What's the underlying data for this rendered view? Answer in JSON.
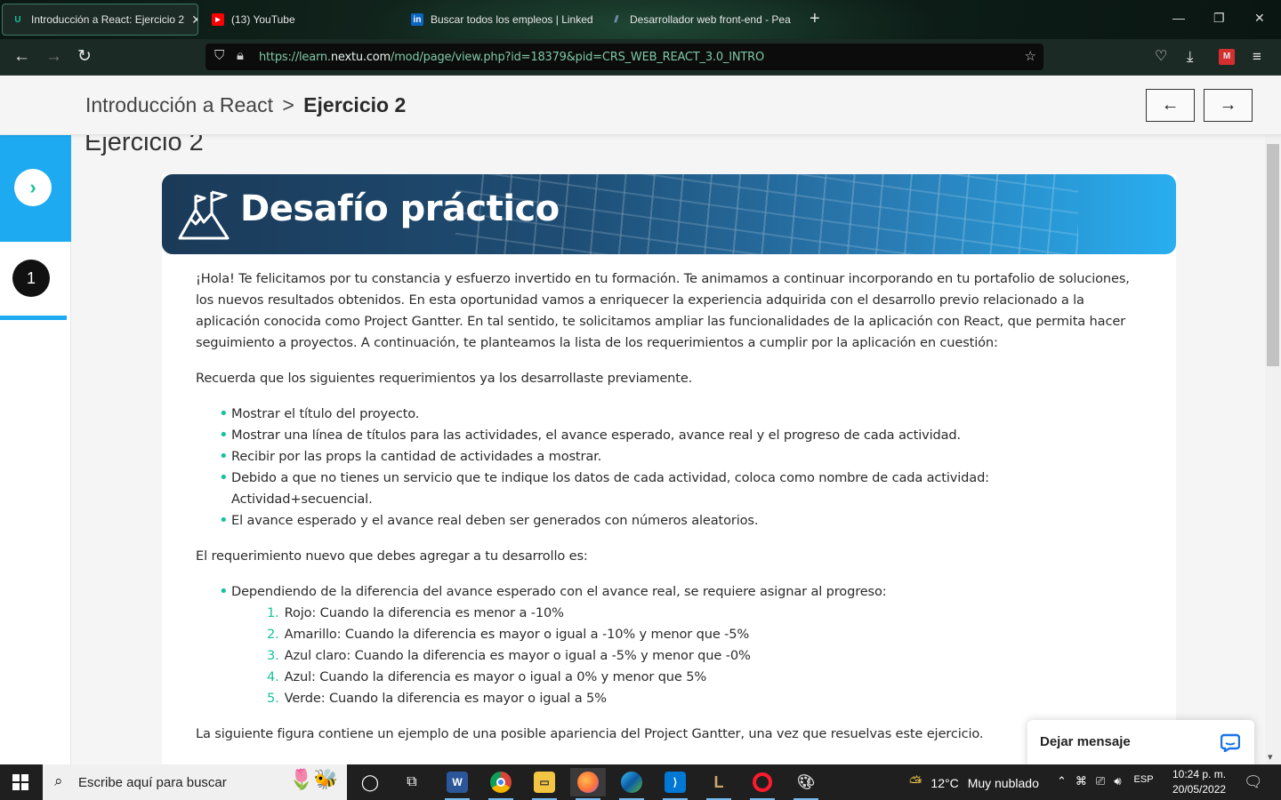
{
  "browser": {
    "tabs": [
      {
        "title": "Introducción a React: Ejercicio 2",
        "favicon": "U",
        "active": true
      },
      {
        "title": "(13) YouTube",
        "favicon": "youtube-icon",
        "active": false
      },
      {
        "title": "Buscar todos los empleos | Linked",
        "favicon": "in",
        "active": false
      },
      {
        "title": "Desarrollador web front-end - Pea",
        "favicon": "pearson-icon",
        "active": false
      }
    ],
    "url_prefix": "https://learn.",
    "url_domain": "nextu.com",
    "url_suffix": "/mod/page/view.php?id=18379&pid=CRS_WEB_REACT_3.0_INTRO"
  },
  "header": {
    "course": "Introducción a React",
    "separator": ">",
    "current": "Ejercicio 2",
    "prev_arrow": "←",
    "next_arrow": "→"
  },
  "sidebar": {
    "lesson_number": "1"
  },
  "main": {
    "page_title": "Ejercicio 2",
    "banner_title": "Desafío práctico",
    "intro": "¡Hola! Te felicitamos por tu constancia y esfuerzo invertido en tu formación. Te animamos a continuar incorporando en tu portafolio de soluciones, los nuevos resultados obtenidos. En esta oportunidad vamos a enriquecer la experiencia adquirida con el desarrollo previo relacionado a la aplicación conocida como Project Gantter. En tal sentido, te solicitamos ampliar las funcionalidades de la aplicación con React, que permita hacer seguimiento a proyectos. A continuación, te planteamos la lista de los requerimientos a cumplir por la aplicación en cuestión:",
    "reminder": "Recuerda que los siguientes requerimientos ya los desarrollaste previamente.",
    "previous_requirements": [
      "Mostrar el título del proyecto.",
      "Mostrar una línea de títulos para las actividades, el avance esperado, avance real y el progreso de cada actividad.",
      "Recibir por las props la cantidad de actividades a mostrar.",
      "Debido a que no tienes un servicio que te indique los datos de cada actividad, coloca como nombre de cada actividad: Actividad+secuencial.",
      "El avance esperado y el avance real deben ser generados con números aleatorios."
    ],
    "new_requirement_intro": "El requerimiento nuevo que debes agregar a tu desarrollo es:",
    "new_requirement": "Dependiendo de la diferencia del avance esperado con el avance real, se requiere asignar al progreso:",
    "progress_rules": [
      {
        "num": "1.",
        "text": "Rojo: Cuando la diferencia es menor a -10%"
      },
      {
        "num": "2.",
        "text": "Amarillo: Cuando la diferencia es mayor o igual a -10% y menor que -5%"
      },
      {
        "num": "3.",
        "text": "Azul claro: Cuando la diferencia es mayor o igual a -5% y menor que -0%"
      },
      {
        "num": "4.",
        "text": "Azul: Cuando la diferencia es mayor o igual a 0% y menor que 5%"
      },
      {
        "num": "5.",
        "text": "Verde: Cuando la diferencia es mayor o igual a 5%"
      }
    ],
    "figure_intro": "La siguiente figura contiene un ejemplo de una posible apariencia del Project Gantter, una vez que resuelvas este ejercicio."
  },
  "chat": {
    "label": "Dejar mensaje"
  },
  "taskbar": {
    "search_placeholder": "Escribe aquí para buscar",
    "weather_temp": "12°C",
    "weather_desc": "Muy nublado",
    "language": "ESP",
    "time": "10:24 p. m.",
    "date": "20/05/2022"
  },
  "colors": {
    "accent_blue": "#1eaaf1",
    "accent_green": "#17c39a",
    "text": "#2b2b2b"
  }
}
